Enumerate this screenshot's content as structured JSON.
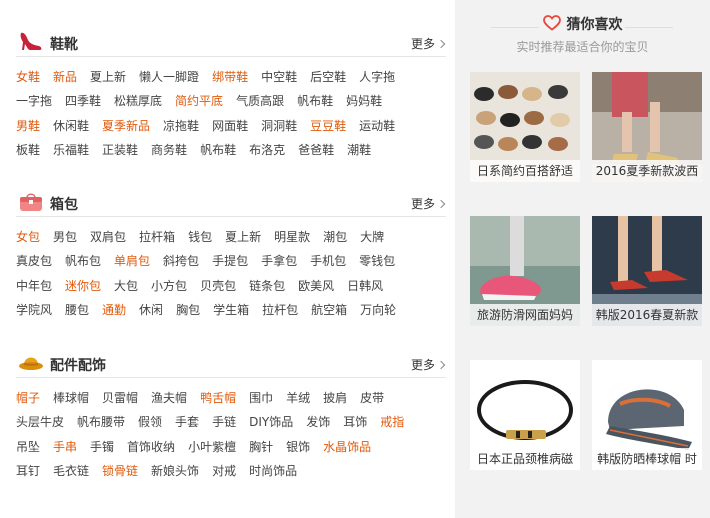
{
  "sections": [
    {
      "title": "鞋靴",
      "icon": "high-heel-icon",
      "more": "更多",
      "rows": [
        [
          {
            "t": "女鞋",
            "hot": true
          },
          {
            "t": "新品",
            "hot": true
          },
          {
            "t": "夏上新"
          },
          {
            "t": "懒人一脚蹬"
          },
          {
            "t": "绑带鞋",
            "hot": true
          },
          {
            "t": "中空鞋"
          },
          {
            "t": "后空鞋"
          },
          {
            "t": "人字拖"
          }
        ],
        [
          {
            "t": "一字拖"
          },
          {
            "t": "四季鞋"
          },
          {
            "t": "松糕厚底"
          },
          {
            "t": "简约平底",
            "hot": true
          },
          {
            "t": "气质高跟"
          },
          {
            "t": "帆布鞋"
          },
          {
            "t": "妈妈鞋"
          }
        ],
        [
          {
            "t": "男鞋",
            "hot": true
          },
          {
            "t": "休闲鞋"
          },
          {
            "t": "夏季新品",
            "hot": true
          },
          {
            "t": "凉拖鞋"
          },
          {
            "t": "网面鞋"
          },
          {
            "t": "洞洞鞋"
          },
          {
            "t": "豆豆鞋",
            "hot": true
          },
          {
            "t": "运动鞋"
          }
        ],
        [
          {
            "t": "板鞋"
          },
          {
            "t": "乐福鞋"
          },
          {
            "t": "正装鞋"
          },
          {
            "t": "商务鞋"
          },
          {
            "t": "帆布鞋"
          },
          {
            "t": "布洛克"
          },
          {
            "t": "爸爸鞋"
          },
          {
            "t": "潮鞋"
          }
        ]
      ]
    },
    {
      "title": "箱包",
      "icon": "handbag-icon",
      "more": "更多",
      "rows": [
        [
          {
            "t": "女包",
            "hot": true
          },
          {
            "t": "男包"
          },
          {
            "t": "双肩包"
          },
          {
            "t": "拉杆箱"
          },
          {
            "t": "钱包"
          },
          {
            "t": "夏上新"
          },
          {
            "t": "明星款"
          },
          {
            "t": "潮包"
          },
          {
            "t": "大牌"
          }
        ],
        [
          {
            "t": "真皮包"
          },
          {
            "t": "帆布包"
          },
          {
            "t": "单肩包",
            "hot": true
          },
          {
            "t": "斜挎包"
          },
          {
            "t": "手提包"
          },
          {
            "t": "手拿包"
          },
          {
            "t": "手机包"
          },
          {
            "t": "零钱包"
          }
        ],
        [
          {
            "t": "中年包"
          },
          {
            "t": "迷你包",
            "hot": true
          },
          {
            "t": "大包"
          },
          {
            "t": "小方包"
          },
          {
            "t": "贝壳包"
          },
          {
            "t": "链条包"
          },
          {
            "t": "欧美风"
          },
          {
            "t": "日韩风"
          }
        ],
        [
          {
            "t": "学院风"
          },
          {
            "t": "腰包"
          },
          {
            "t": "通勤",
            "hot": true
          },
          {
            "t": "休闲"
          },
          {
            "t": "胸包"
          },
          {
            "t": "学生箱"
          },
          {
            "t": "拉杆包"
          },
          {
            "t": "航空箱"
          },
          {
            "t": "万向轮"
          }
        ]
      ]
    },
    {
      "title": "配件配饰",
      "icon": "hat-icon",
      "more": "更多",
      "rows": [
        [
          {
            "t": "帽子",
            "hot": true
          },
          {
            "t": "棒球帽"
          },
          {
            "t": "贝雷帽"
          },
          {
            "t": "渔夫帽"
          },
          {
            "t": "鸭舌帽",
            "hot": true
          },
          {
            "t": "围巾"
          },
          {
            "t": "羊绒"
          },
          {
            "t": "披肩"
          },
          {
            "t": "皮带"
          }
        ],
        [
          {
            "t": "头层牛皮"
          },
          {
            "t": "帆布腰带"
          },
          {
            "t": "假领"
          },
          {
            "t": "手套"
          },
          {
            "t": "手链"
          },
          {
            "t": "DIY饰品"
          },
          {
            "t": "发饰"
          },
          {
            "t": "耳饰"
          },
          {
            "t": "戒指",
            "hot": true
          }
        ],
        [
          {
            "t": "吊坠"
          },
          {
            "t": "手串",
            "hot": true
          },
          {
            "t": "手镯"
          },
          {
            "t": "首饰收纳"
          },
          {
            "t": "小叶紫檀"
          },
          {
            "t": "胸针"
          },
          {
            "t": "银饰"
          },
          {
            "t": "水晶饰品",
            "hot": true
          }
        ],
        [
          {
            "t": "耳钉"
          },
          {
            "t": "毛衣链"
          },
          {
            "t": "锁骨链",
            "hot": true
          },
          {
            "t": "新娘头饰"
          },
          {
            "t": "对戒"
          },
          {
            "t": "时尚饰品"
          }
        ]
      ]
    }
  ],
  "recommend": {
    "title": "猜你喜欢",
    "subtitle": "实时推荐最适合你的宝贝",
    "items": [
      {
        "caption": "日系简约百搭舒适",
        "image": "sandals-grid-photo"
      },
      {
        "caption": "2016夏季新款波西",
        "image": "woman-sandals-photo"
      },
      {
        "caption": "旅游防滑网面妈妈",
        "image": "pink-sneaker-photo"
      },
      {
        "caption": "韩版2016春夏新款",
        "image": "pointed-flats-photo"
      },
      {
        "caption": "日本正品颈椎病磁",
        "image": "magnetic-necklace-photo"
      },
      {
        "caption": "韩版防晒棒球帽 时",
        "image": "baseball-cap-photo"
      }
    ]
  },
  "colors": {
    "accent": "#e05a0c",
    "panel": "#f2f2f2",
    "heart": "#e8463c"
  }
}
